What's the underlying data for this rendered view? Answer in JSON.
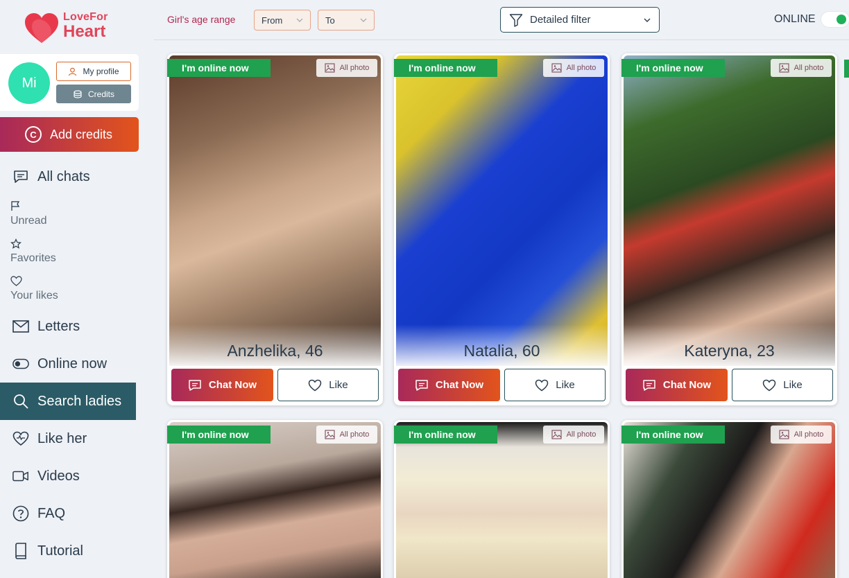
{
  "brand": {
    "line1": "LoveFor",
    "line2": "Heart"
  },
  "profile": {
    "avatar_initials": "Mi",
    "my_profile_label": "My profile",
    "credits_label": "Credits"
  },
  "add_credits": {
    "coin": "C",
    "label": "Add credits"
  },
  "nav": {
    "all_chats": "All chats",
    "unread": "Unread",
    "favorites": "Favorites",
    "your_likes": "Your likes",
    "letters": "Letters",
    "online_now": "Online now",
    "search_ladies": "Search ladies",
    "like_her": "Like her",
    "videos": "Videos",
    "faq": "FAQ",
    "tutorial": "Tutorial"
  },
  "filters": {
    "age_label": "Girl's age range",
    "from": "From",
    "to": "To",
    "detailed": "Detailed filter",
    "online_label": "ONLINE",
    "online_toggle": true
  },
  "cards": [
    {
      "online": "I'm online now",
      "allphoto": "All photo",
      "name": "Anzhelika, 46",
      "chat": "Chat Now",
      "like": "Like"
    },
    {
      "online": "I'm online now",
      "allphoto": "All photo",
      "name": "Natalia, 60",
      "chat": "Chat Now",
      "like": "Like"
    },
    {
      "online": "I'm online now",
      "allphoto": "All photo",
      "name": "Kateryna, 23",
      "chat": "Chat Now",
      "like": "Like"
    },
    {
      "online": "I'm online now",
      "allphoto": "All photo"
    },
    {
      "online": "I'm online now",
      "allphoto": "All photo"
    },
    {
      "online": "I'm online now",
      "allphoto": "All photo"
    }
  ],
  "colors": {
    "accent_gradient_start": "#a8295a",
    "accent_gradient_end": "#e2541c",
    "teal": "#27515c",
    "online_green": "#1fa14f"
  }
}
